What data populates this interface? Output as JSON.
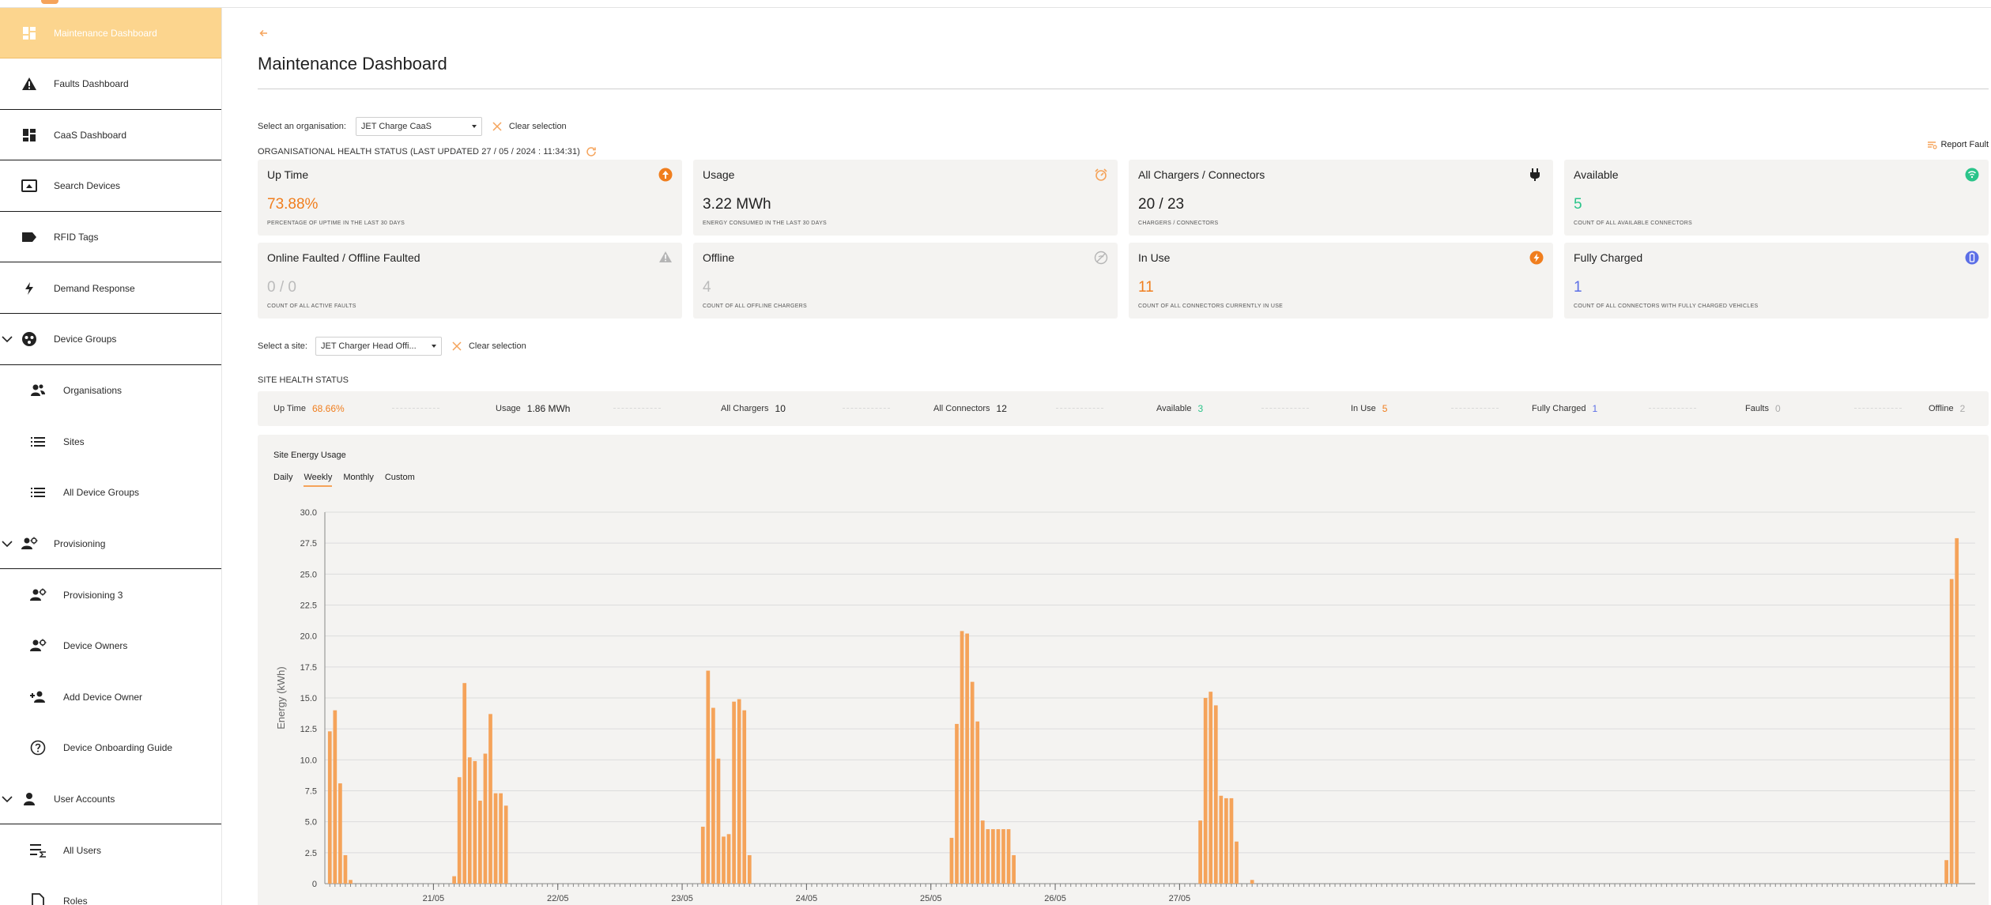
{
  "sidebar": {
    "items": [
      {
        "label": "Maintenance Dashboard",
        "icon": "dashboard-icon",
        "active": true
      },
      {
        "label": "Faults Dashboard",
        "icon": "warning-icon"
      },
      {
        "label": "CaaS Dashboard",
        "icon": "dashboard-icon"
      },
      {
        "label": "Search Devices",
        "icon": "device-search-icon"
      },
      {
        "label": "RFID Tags",
        "icon": "tag-icon"
      },
      {
        "label": "Demand Response",
        "icon": "bolt-icon"
      },
      {
        "label": "Device Groups",
        "icon": "device-groups-icon",
        "expanded": true
      },
      {
        "label": "Organisations",
        "icon": "organisations-icon",
        "sub": true
      },
      {
        "label": "Sites",
        "icon": "list-icon",
        "sub": true
      },
      {
        "label": "All Device Groups",
        "icon": "list-icon",
        "sub": true
      },
      {
        "label": "Provisioning",
        "icon": "provisioning-icon",
        "expanded": true
      },
      {
        "label": "Provisioning 3",
        "icon": "provisioning-icon",
        "sub": true
      },
      {
        "label": "Device Owners",
        "icon": "provisioning-icon",
        "sub": true
      },
      {
        "label": "Add Device Owner",
        "icon": "add-person-icon",
        "sub": true
      },
      {
        "label": "Device Onboarding Guide",
        "icon": "help-icon",
        "sub": true
      },
      {
        "label": "User Accounts",
        "icon": "person-icon",
        "expanded": true
      },
      {
        "label": "All Users",
        "icon": "user-list-icon",
        "sub": true
      },
      {
        "label": "Roles",
        "icon": "document-icon",
        "sub": true
      }
    ]
  },
  "header": {
    "title": "Maintenance Dashboard"
  },
  "org": {
    "label": "Select an organisation:",
    "value": "JET Charge CaaS",
    "clear": "Clear selection"
  },
  "org_status": {
    "text": "ORGANISATIONAL HEALTH STATUS (LAST UPDATED 27 / 05 / 2024 : 11:34:31)",
    "report": "Report Fault"
  },
  "cards": [
    {
      "title": "Up Time",
      "value": "73.88%",
      "sub": "PERCENTAGE OF UPTIME IN THE LAST 30 DAYS",
      "color": "#f07e1e",
      "icon": "uptime-icon"
    },
    {
      "title": "Usage",
      "value": "3.22 MWh",
      "sub": "ENERGY CONSUMED IN THE LAST 30 DAYS",
      "color": "#222222",
      "icon": "usage-icon"
    },
    {
      "title": "All Chargers / Connectors",
      "value": "20 / 23",
      "sub": "CHARGERS / CONNECTORS",
      "color": "#222222",
      "icon": "plug-icon"
    },
    {
      "title": "Available",
      "value": "5",
      "sub": "COUNT OF ALL AVAILABLE CONNECTORS",
      "color": "#2bc48a",
      "icon": "available-icon"
    },
    {
      "title": "Online Faulted / Offline Faulted",
      "value": "0 / 0",
      "sub": "COUNT OF ALL ACTIVE FAULTS",
      "color": "#bbbbbb",
      "icon": "fault-icon"
    },
    {
      "title": "Offline",
      "value": "4",
      "sub": "COUNT OF ALL OFFLINE CHARGERS",
      "color": "#bbbbbb",
      "icon": "offline-icon"
    },
    {
      "title": "In Use",
      "value": "11",
      "sub": "COUNT OF ALL CONNECTORS CURRENTLY IN USE",
      "color": "#f07e1e",
      "icon": "in-use-icon"
    },
    {
      "title": "Fully Charged",
      "value": "1",
      "sub": "COUNT OF ALL CONNECTORS WITH FULLY CHARGED VEHICLES",
      "color": "#5b6ee6",
      "icon": "fully-charged-icon"
    }
  ],
  "site": {
    "label": "Select a site:",
    "value": "JET Charger Head Offi...",
    "clear": "Clear selection",
    "health_label": "SITE HEALTH STATUS"
  },
  "site_stats": [
    {
      "label": "Up Time",
      "value": "68.66%",
      "color": "#f07e1e"
    },
    {
      "label": "Usage",
      "value": "1.86 MWh",
      "color": "#222222"
    },
    {
      "label": "All Chargers",
      "value": "10",
      "color": "#222222"
    },
    {
      "label": "All Connectors",
      "value": "12",
      "color": "#222222"
    },
    {
      "label": "Available",
      "value": "3",
      "color": "#2bc48a"
    },
    {
      "label": "In Use",
      "value": "5",
      "color": "#f07e1e"
    },
    {
      "label": "Fully Charged",
      "value": "1",
      "color": "#5b6ee6"
    },
    {
      "label": "Faults",
      "value": "0",
      "color": "#aaaaaa"
    },
    {
      "label": "Offline",
      "value": "2",
      "color": "#aaaaaa"
    }
  ],
  "energy": {
    "title": "Site Energy Usage",
    "tabs": [
      "Daily",
      "Weekly",
      "Monthly",
      "Custom"
    ],
    "active_tab": "Weekly"
  },
  "chart_data": {
    "type": "bar",
    "title": "Site Energy Usage",
    "xlabel": "",
    "ylabel": "Energy (kWh)",
    "ylim": [
      0,
      30
    ],
    "yticks": [
      "0",
      "2.5",
      "5.0",
      "7.5",
      "10.0",
      "12.5",
      "15.0",
      "17.5",
      "20.0",
      "22.5",
      "25.0",
      "27.5",
      "30.0"
    ],
    "day_labels": [
      "21/05",
      "22/05",
      "23/05",
      "24/05",
      "25/05",
      "26/05",
      "27/05"
    ],
    "bar_color": "#f5a35a",
    "grid": true,
    "values": [
      12.3,
      14.0,
      8.1,
      2.3,
      0.3,
      0,
      0,
      0,
      0,
      0,
      0,
      0,
      0,
      0,
      0,
      0,
      0,
      0,
      0,
      0,
      0,
      0,
      0,
      0,
      0.6,
      8.6,
      16.2,
      10.2,
      9.9,
      6.7,
      10.5,
      13.7,
      7.3,
      7.3,
      6.3,
      0,
      0,
      0,
      0,
      0,
      0,
      0,
      0,
      0,
      0,
      0,
      0,
      0,
      0,
      0,
      0,
      0,
      0,
      0,
      0,
      0,
      0,
      0,
      0,
      0,
      0,
      0,
      0,
      0,
      0,
      0,
      0,
      0,
      0,
      0,
      0,
      0,
      4.6,
      17.2,
      14.2,
      10.1,
      3.8,
      4.0,
      14.7,
      14.9,
      14.0,
      2.3,
      0,
      0,
      0,
      0,
      0,
      0,
      0,
      0,
      0,
      0,
      0,
      0,
      0,
      0,
      0,
      0,
      0,
      0,
      0,
      0,
      0,
      0,
      0,
      0,
      0,
      0,
      0,
      0,
      0,
      0,
      0,
      0,
      0,
      0,
      0,
      0,
      0,
      0,
      3.7,
      12.9,
      20.4,
      20.2,
      16.3,
      13.1,
      5.1,
      4.4,
      4.4,
      4.4,
      4.4,
      4.4,
      2.3,
      0,
      0,
      0,
      0,
      0,
      0,
      0,
      0,
      0,
      0,
      0,
      0,
      0,
      0,
      0,
      0,
      0,
      0,
      0,
      0,
      0,
      0,
      0,
      0,
      0,
      0,
      0,
      0,
      0,
      0,
      0,
      0,
      0,
      0,
      0,
      5.1,
      15.0,
      15.5,
      14.4,
      7.1,
      6.9,
      6.9,
      3.4,
      0,
      0,
      0.3,
      0,
      0,
      0,
      0,
      0,
      0,
      0,
      0,
      0,
      0,
      0,
      0,
      0,
      0,
      0,
      0,
      0,
      0,
      0,
      0,
      0,
      0,
      0,
      0,
      0,
      0,
      0,
      0,
      0,
      0,
      0,
      0,
      0,
      0,
      0,
      0,
      0,
      0,
      0,
      0,
      0,
      0,
      0,
      0,
      0,
      0,
      0,
      0,
      0,
      0,
      0,
      0,
      0,
      0,
      0,
      0,
      0,
      0,
      0,
      0,
      0,
      0,
      0,
      0,
      0,
      0,
      0,
      0,
      0,
      0,
      0,
      0,
      0,
      0,
      0,
      0,
      0,
      0,
      0,
      0,
      0,
      0,
      0,
      0,
      0,
      0,
      0,
      0,
      0,
      0,
      0,
      0,
      0,
      0,
      0,
      0,
      0,
      0,
      0,
      0,
      0,
      0,
      0,
      0,
      0,
      0,
      0,
      0,
      0,
      0,
      0,
      0,
      0,
      0,
      0,
      0,
      0,
      0,
      0,
      0,
      0,
      0,
      0,
      0,
      0,
      0,
      0,
      0,
      0,
      0,
      0,
      0,
      0,
      1.9,
      24.6,
      27.9
    ]
  }
}
